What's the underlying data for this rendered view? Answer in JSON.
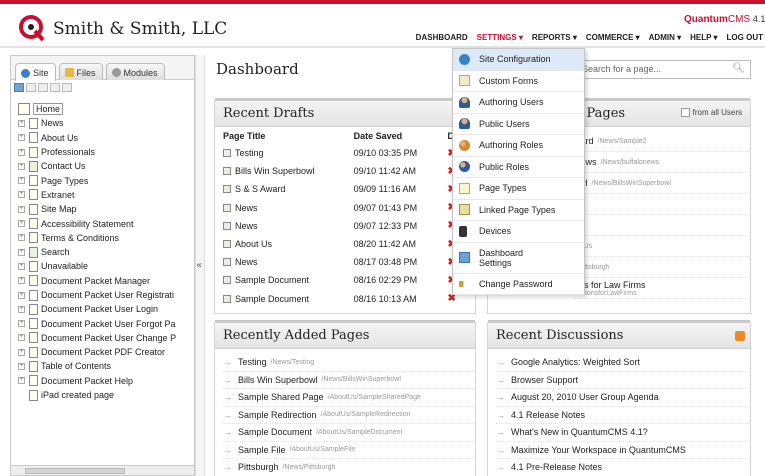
{
  "header": {
    "site_name": "Smith & Smith, LLC",
    "brand_quantum": "Quantum",
    "brand_cms": "CMS",
    "brand_version": "4.1",
    "nav": [
      {
        "label": "DASHBOARD"
      },
      {
        "label": "SETTINGS ▾"
      },
      {
        "label": "REPORTS ▾"
      },
      {
        "label": "COMMERCE ▾"
      },
      {
        "label": "ADMIN ▾"
      },
      {
        "label": "HELP ▾"
      },
      {
        "label": "LOG OUT"
      }
    ],
    "colors": {
      "accent": "#c8102e"
    }
  },
  "left_panel": {
    "tabs": [
      {
        "label": "Site",
        "icon": "globe-icon"
      },
      {
        "label": "Files",
        "icon": "folder-icon"
      },
      {
        "label": "Modules",
        "icon": "gear-icon"
      }
    ],
    "tree": {
      "root": "Home",
      "children": [
        "News",
        "About Us",
        "Professionals",
        "Contact Us",
        "Page Types",
        "Extranet",
        "Site Map",
        "Accessibility Statement",
        "Terms & Conditions",
        "Search",
        "Unavailable",
        "Document Packet Manager",
        "Document Packet User Registrati",
        "Document Packet User Login",
        "Document Packet User Forgot Pa",
        "Document Packet User Change P",
        "Document Packet PDF Creator",
        "Table of Contents",
        "Document Packet Help",
        "iPad created page"
      ]
    },
    "collapse_glyph": "«"
  },
  "main": {
    "title": "Dashboard",
    "search_placeholder": "Search for a page...",
    "recent_drafts": {
      "title": "Recent Drafts",
      "columns": [
        "Page Title",
        "Date Saved",
        "Disc"
      ],
      "rows": [
        {
          "title": "Testing",
          "date": "09/10 03:35 PM"
        },
        {
          "title": "Bills Win Superbowl",
          "date": "09/10 11:42 AM"
        },
        {
          "title": "S & S Award",
          "date": "09/09 11:16 AM"
        },
        {
          "title": "News",
          "date": "09/07 01:43 PM"
        },
        {
          "title": "News",
          "date": "09/07 12:33 PM"
        },
        {
          "title": "About Us",
          "date": "08/20 11:42 AM"
        },
        {
          "title": "News",
          "date": "08/17 03:48 PM"
        },
        {
          "title": "Sample Document",
          "date": "08/16 02:29 PM"
        },
        {
          "title": "Sample Document",
          "date": "08/16 10:13 AM"
        }
      ]
    },
    "recent_pages": {
      "title": "d Pages",
      "checkbox_label": "from all Users",
      "items": [
        {
          "label": "ward",
          "path": "/News/Sample2"
        },
        {
          "label": "News",
          "path": "/News/buffalonews"
        },
        {
          "label": "bwl",
          "path": "/News/BillsWinSuperbowl"
        },
        {
          "label": "",
          "path": ""
        },
        {
          "label": "",
          "path": ""
        },
        {
          "label": "",
          "path": "ctUs"
        },
        {
          "label": "",
          "path": "Pittsburgh"
        },
        {
          "label": "ons for Law Firms",
          "path": "olutionsforLawFirms"
        }
      ]
    },
    "recently_added": {
      "title": "Recently Added Pages",
      "items": [
        {
          "label": "Testing",
          "path": "/News/Testing"
        },
        {
          "label": "Bills Win Superbowl",
          "path": "/News/BillsWinSuperbowl"
        },
        {
          "label": "Sample Shared Page",
          "path": "/AboutUs/SampleSharedPage"
        },
        {
          "label": "Sample Redirection",
          "path": "/AboutUs/SampleRedirection"
        },
        {
          "label": "Sample Document",
          "path": "/AboutUs/SampleDocument"
        },
        {
          "label": "Sample File",
          "path": "/AboutUs/SampleFile"
        },
        {
          "label": "Pittsburgh",
          "path": "/News/Pittsburgh"
        }
      ]
    },
    "recent_discussions": {
      "title": "Recent Discussions",
      "items": [
        "Google Analytics: Weighted Sort",
        "Browser Support",
        "August 20, 2010 User Group Agenda",
        "4.1 Release Notes",
        "What's New in QuantumCMS 4.1?",
        "Maximize Your Workspace in QuantumCMS",
        "4.1 Pre-Release Notes"
      ]
    }
  },
  "settings_menu": {
    "items": [
      {
        "label": "Site Configuration",
        "icon": "globe-icon"
      },
      {
        "label": "Custom Forms",
        "icon": "form-icon"
      },
      {
        "label": "Authoring Users",
        "icon": "user-icon"
      },
      {
        "label": "Public Users",
        "icon": "user-icon"
      },
      {
        "label": "Authoring Roles",
        "icon": "users-icon"
      },
      {
        "label": "Public Roles",
        "icon": "users-icon"
      },
      {
        "label": "Page Types",
        "icon": "page-type-icon"
      },
      {
        "label": "Linked Page Types",
        "icon": "linked-page-icon"
      },
      {
        "label": "Devices",
        "icon": "device-icon"
      },
      {
        "label": "Dashboard\nSettings",
        "icon": "dashboard-icon"
      },
      {
        "label": "Change Password",
        "icon": "key-icon"
      }
    ]
  }
}
